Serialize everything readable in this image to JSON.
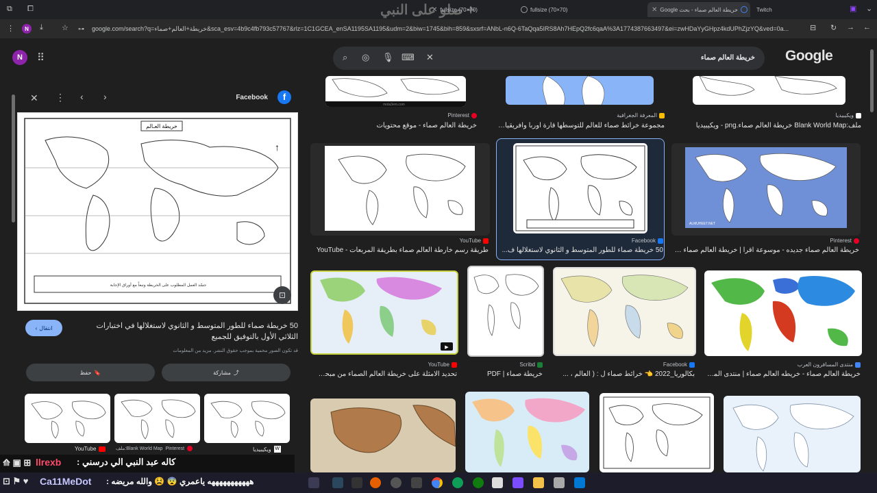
{
  "tabs": [
    {
      "label": "fullsize (70×70)"
    },
    {
      "label": "fullsize (70×70)"
    },
    {
      "label": "خريطة العالم صماء - بحث Google"
    },
    {
      "label": "Twitch"
    }
  ],
  "watermark_text": "صلو على النبي +",
  "address": {
    "url": "google.com/search?q=خريطة+العالم+صماء&sca_esv=4b9c4fb793c57767&rlz=1C1GCEA_enSA1195SA1195&udm=2&biw=1745&bih=859&sxsrf=ANbL-n6Q-6TaQqa5IRS8Ah7HEpQ2fc6qaA%3A1774387663497&ei=zwHDaYyGHpz4kdUPhZjzYQ&ved=0a..."
  },
  "profile_letter": "N",
  "search": {
    "query": "خريطة العالم صماء",
    "logo": "Google"
  },
  "panel": {
    "source": "Facebook",
    "title": "50 خريطة صماء للطور المتوسط و الثانوي لاستغلالها في اختبارات الثلاثي الأول بالتوفيق للجميع",
    "note": "قد تكون الصور محمية بموجب حقوق النشر. مزيد من المعلومات",
    "visit_label": "انتقال",
    "share_label": "مشاركة",
    "save_label": "حفظ",
    "map_title": "خريطة العـالم",
    "map_caption": "جسّد العمل المطلوب على الخريطة وتبعاً مع أوراق الإجابة",
    "related": [
      {
        "source": "YouTube"
      },
      {
        "source": "Pinterest",
        "caption": "ملف:Blank World Map"
      },
      {
        "source": "ويكيبيديا"
      }
    ]
  },
  "results": [
    {
      "source": "Pinterest",
      "caption": "خريطة العالم صماء - موقع محتويات"
    },
    {
      "source": "المعرفة الجغرافية",
      "caption": "مجموعة خرائط صماء للعالم للتوسطها قارة أوربا وافريقيا - المعر..."
    },
    {
      "source": "ويكيبيديا",
      "caption": "ملف:Blank World Map خريطة العالم صماء.png - ويكيبيديا"
    },
    {
      "source": "YouTube",
      "caption": "طريقة رسم خارطة العالم صماء بطريقة المربعات - YouTube"
    },
    {
      "source": "Facebook",
      "caption": "50 خريطة صماء للطور المتوسط و الثانوي لاستغلالها ف..."
    },
    {
      "source": "Pinterest",
      "caption": "خريطة العالم صماء جديده - موسوعة اقرأ | خريطة العالم صماء ملون..."
    },
    {
      "source": "YouTube",
      "caption": "تحديد الامثلة على خريطة العالم الصماء من مبحث ال..."
    },
    {
      "source": "Scribd",
      "caption": "خريطة صماء | PDF"
    },
    {
      "source": "Facebook",
      "caption": "بكالوريا_2022 👈 خرائط صماء ل : ( العالم ، ..."
    },
    {
      "source": "منتدى المسافرون العرب",
      "caption": "خريطة العالم صماء - خريطه العالم صماء | منتدى المس..."
    }
  ],
  "grid_map_label": "ALMUHEET.NET",
  "thumb_watermark": "mota3em.com",
  "overlay": {
    "stream_name": "llrexb",
    "line1": "كاله عبد النبي الي درسني :",
    "line2": "هههههههههههه ياعمري 😨 😫 والله مريضه :",
    "user2": "Ca11MeDot"
  }
}
